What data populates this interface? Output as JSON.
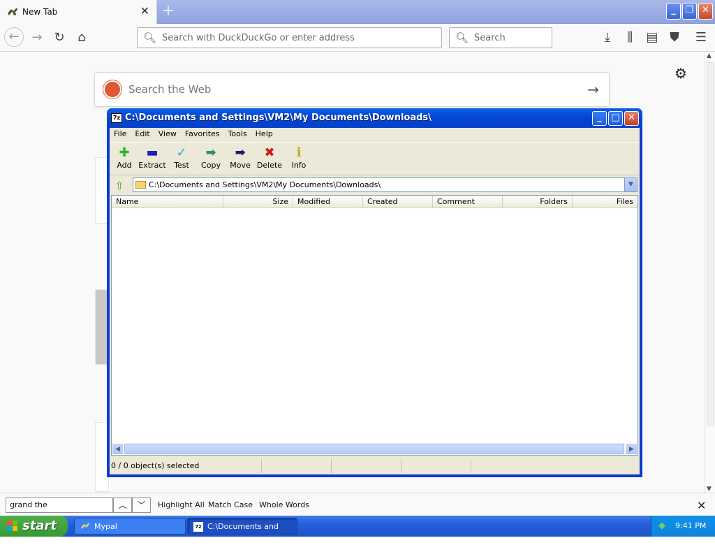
{
  "browser": {
    "tab_title": "New Tab",
    "tab_close": "✕",
    "new_tab": "+",
    "url_placeholder": "Search with DuckDuckGo or enter address",
    "search_placeholder": "Search",
    "page_search_placeholder": "Search the Web",
    "icons": [
      "back-icon",
      "forward-icon",
      "reload-icon",
      "home-icon",
      "download-icon",
      "library-icon",
      "sidebar-icon",
      "ublock-icon",
      "menu-icon",
      "gear-icon"
    ]
  },
  "findbar": {
    "query": "grand the",
    "highlight_all": "Highlight All",
    "match_case": "Match Case",
    "whole_words": "Whole Words"
  },
  "taskbar": {
    "start": "start",
    "tasks": [
      {
        "label": "Mypal"
      },
      {
        "label": "C:\\Documents and Se..."
      }
    ],
    "clock": "9:41 PM"
  },
  "zip": {
    "title": "C:\\Documents and Settings\\VM2\\My Documents\\Downloads\\",
    "app_icon_text": "7z",
    "menu": [
      "File",
      "Edit",
      "View",
      "Favorites",
      "Tools",
      "Help"
    ],
    "toolbar": [
      {
        "label": "Add",
        "icon": "add-icon"
      },
      {
        "label": "Extract",
        "icon": "extract-icon"
      },
      {
        "label": "Test",
        "icon": "test-icon"
      },
      {
        "label": "Copy",
        "icon": "copy-icon"
      },
      {
        "label": "Move",
        "icon": "move-icon"
      },
      {
        "label": "Delete",
        "icon": "delete-icon"
      },
      {
        "label": "Info",
        "icon": "info-icon"
      }
    ],
    "path": "C:\\Documents and Settings\\VM2\\My Documents\\Downloads\\",
    "columns": [
      "Name",
      "Size",
      "Modified",
      "Created",
      "Comment",
      "Folders",
      "Files"
    ],
    "rows": [],
    "status": "0 / 0 object(s) selected"
  }
}
